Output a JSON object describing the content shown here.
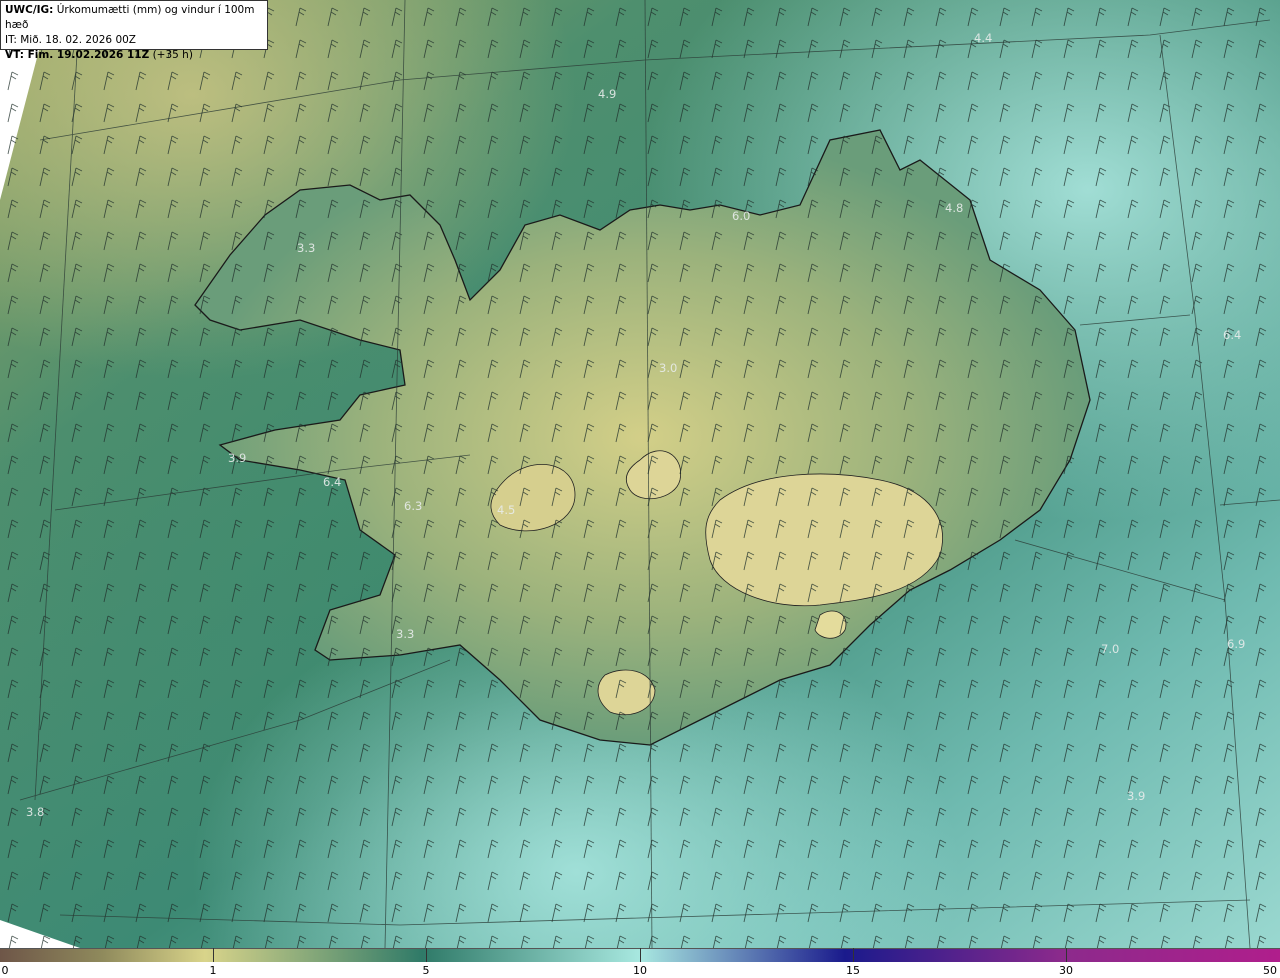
{
  "header": {
    "product": "UWC/IG:",
    "description": "Úrkomumætti (mm) og vindur í 100m hæð",
    "init_time": "IT: Mið. 18. 02. 2026 00Z",
    "valid_prefix": "VT: Fim. 19.02.2026 11Z",
    "valid_offset": "(+35 h)"
  },
  "map": {
    "value_labels": [
      "4.9",
      "4.4",
      "3.3",
      "6.0",
      "4.8",
      "6.4",
      "3.0",
      "3.9",
      "6.4",
      "6.3",
      "4.5",
      "3.3",
      "7.0",
      "6.9",
      "3.8",
      "3.9"
    ]
  },
  "colorbar": {
    "ticks": [
      "0",
      "1",
      "5",
      "10",
      "15",
      "30",
      "50"
    ],
    "colors": [
      "#6e5648",
      "#8f8a5c",
      "#d9d48a",
      "#2f7a68",
      "#a8e8e0",
      "#1a1a8c",
      "#8c2a8c",
      "#b01e8c"
    ]
  }
}
